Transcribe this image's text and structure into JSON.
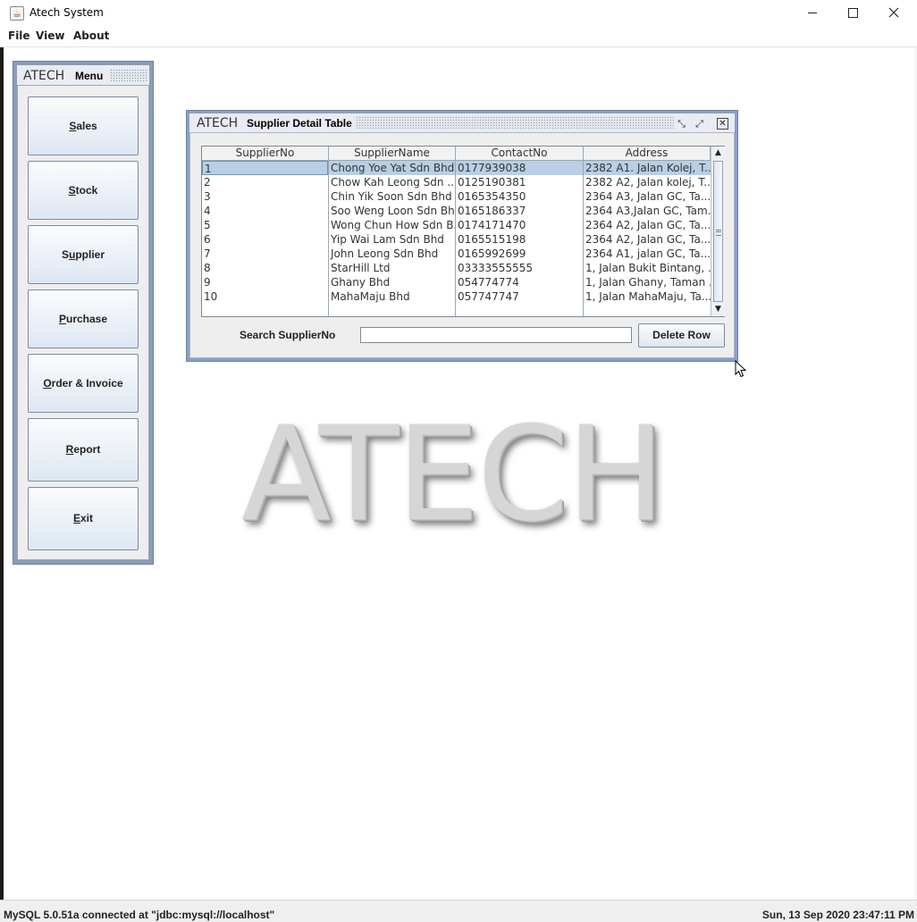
{
  "window": {
    "title": "Atech System",
    "icon": "java-cup-icon"
  },
  "menubar": [
    "File",
    "View",
    "About"
  ],
  "menu_frame": {
    "logo": "ATECH",
    "title": "Menu",
    "buttons": [
      {
        "label": "Sales",
        "mnemonic": "S"
      },
      {
        "label": "Stock",
        "mnemonic": "S"
      },
      {
        "label": "Supplier",
        "mnemonic": "u"
      },
      {
        "label": "Purchase",
        "mnemonic": "P"
      },
      {
        "label": "Order & Invoice",
        "mnemonic": "O"
      },
      {
        "label": "Report",
        "mnemonic": "R"
      },
      {
        "label": "Exit",
        "mnemonic": "E"
      }
    ]
  },
  "table_frame": {
    "logo": "ATECH",
    "title": "Supplier Detail Table",
    "columns": [
      "SupplierNo",
      "SupplierName",
      "ContactNo",
      "Address"
    ],
    "rows": [
      [
        "1",
        "Chong Yoe Yat Sdn Bhd",
        "0177939038",
        "2382 A1. Jalan Kolej, T..."
      ],
      [
        "2",
        "Chow Kah Leong Sdn ...",
        "0125190381",
        "2382 A2, Jalan kolej, T..."
      ],
      [
        "3",
        "Chin Yik Soon Sdn Bhd",
        "0165354350",
        "2364 A3, Jalan GC, Ta..."
      ],
      [
        "4",
        "Soo Weng Loon Sdn Bhd",
        "0165186337",
        "2364 A3,Jalan GC, Tam..."
      ],
      [
        "5",
        "Wong Chun How Sdn B...",
        "0174171470",
        "2364 A2, Jalan GC, Ta..."
      ],
      [
        "6",
        "Yip Wai Lam  Sdn Bhd",
        "0165515198",
        "2364 A2, Jalan GC, Ta..."
      ],
      [
        "7",
        "John Leong Sdn Bhd",
        "0165992699",
        "2364 A1,  jalan GC, Ta..."
      ],
      [
        "8",
        "StarHill Ltd",
        "03333555555",
        "1, Jalan Bukit Bintang, ..."
      ],
      [
        "9",
        "Ghany Bhd",
        "054774774",
        "1, Jalan Ghany, Taman ..."
      ],
      [
        "10",
        "MahaMaju Bhd",
        "057747747",
        "1, Jalan MahaMaju, Ta..."
      ]
    ],
    "selected_row": 0,
    "search_label": "Search SupplierNo",
    "search_value": "",
    "delete_label": "Delete Row"
  },
  "logo_text": "ATECH",
  "status": {
    "connection": "MySQL 5.0.51a connected at \"jdbc:mysql://localhost\"",
    "datetime": "Sun, 13 Sep 2020 23:47:11 PM"
  },
  "colors": {
    "frame_border": "#8aa0c4",
    "selection": "#b8cfe5",
    "button_gradient_top": "#fbfcfd",
    "button_gradient_bottom": "#dde7f2"
  }
}
